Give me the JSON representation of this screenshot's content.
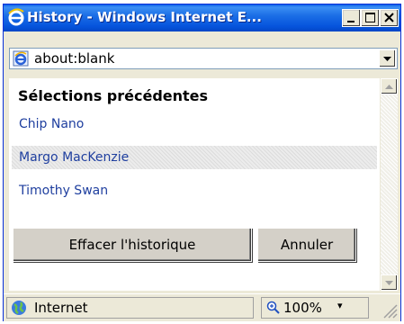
{
  "window": {
    "title": "History - Windows Internet E...",
    "icon": "ie-icon",
    "controls": [
      "minimize-icon",
      "maximize-icon",
      "close-icon"
    ]
  },
  "address_bar": {
    "value": "about:blank",
    "icon": "ie-page-icon"
  },
  "content": {
    "heading": "Sélections précédentes",
    "items": [
      {
        "label": "Chip Nano"
      },
      {
        "label": "Margo MacKenzie"
      },
      {
        "label": "Timothy Swan"
      }
    ],
    "buttons": {
      "clear": "Effacer l'historique",
      "cancel": "Annuler"
    }
  },
  "status_bar": {
    "zone": "Internet",
    "zoom": "100%",
    "zoom_dropdown": "▾"
  },
  "colors": {
    "titlebar": "#0654dd",
    "link": "#1f3f9f",
    "face": "#ece9d8"
  }
}
